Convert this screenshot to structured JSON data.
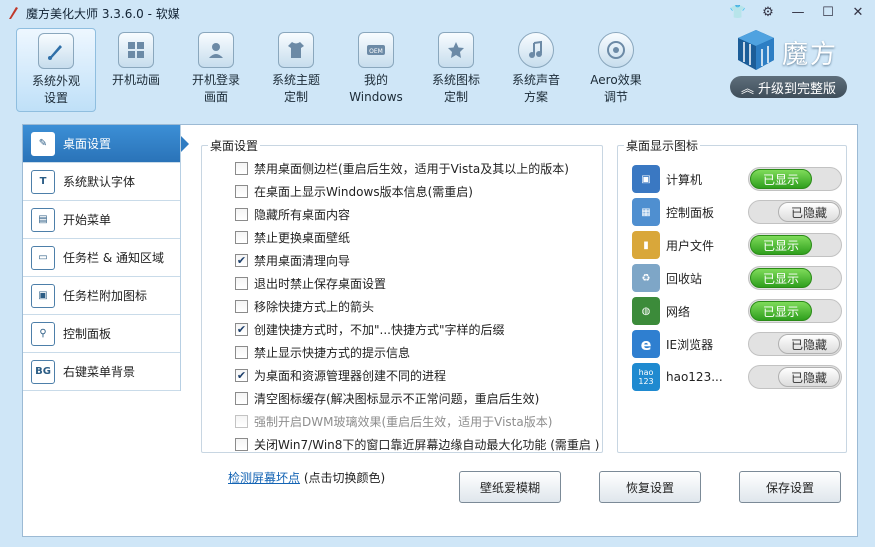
{
  "window": {
    "title": "魔方美化大师 3.3.6.0 - 软媒"
  },
  "nav": [
    {
      "label": "系统外观\n设置",
      "icon": "brush-icon"
    },
    {
      "label": "开机动画",
      "icon": "windows-logo-icon"
    },
    {
      "label": "开机登录\n画面",
      "icon": "user-login-icon"
    },
    {
      "label": "系统主题\n定制",
      "icon": "shirt-icon"
    },
    {
      "label": "我的\nWindows",
      "icon": "oem-icon"
    },
    {
      "label": "系统图标\n定制",
      "icon": "star-icon"
    },
    {
      "label": "系统声音\n方案",
      "icon": "music-note-icon"
    },
    {
      "label": "Aero效果\n调节",
      "icon": "disc-icon"
    }
  ],
  "brand": {
    "name": "魔方",
    "upgrade": "升级到完整版"
  },
  "sidebar": [
    {
      "label": "桌面设置",
      "icon": "desktop-settings-icon",
      "glyph": "✎"
    },
    {
      "label": "系统默认字体",
      "icon": "font-icon",
      "glyph": "T"
    },
    {
      "label": "开始菜单",
      "icon": "start-menu-icon",
      "glyph": "▤"
    },
    {
      "label": "任务栏 & 通知区域",
      "icon": "taskbar-icon",
      "glyph": "▭"
    },
    {
      "label": "任务栏附加图标",
      "icon": "taskbar-extra-icon",
      "glyph": "▣"
    },
    {
      "label": "控制面板",
      "icon": "control-panel-icon",
      "glyph": "⚲"
    },
    {
      "label": "右键菜单背景",
      "icon": "context-menu-bg-icon",
      "glyph": "BG"
    }
  ],
  "desktop_settings": {
    "title": "桌面设置",
    "options": [
      {
        "label": "禁用桌面侧边栏(重启后生效，适用于Vista及其以上的版本)",
        "checked": false,
        "disabled": false
      },
      {
        "label": "在桌面上显示Windows版本信息(需重启)",
        "checked": false,
        "disabled": false
      },
      {
        "label": "隐藏所有桌面内容",
        "checked": false,
        "disabled": false
      },
      {
        "label": "禁止更换桌面壁纸",
        "checked": false,
        "disabled": false
      },
      {
        "label": "禁用桌面清理向导",
        "checked": true,
        "disabled": false
      },
      {
        "label": "退出时禁止保存桌面设置",
        "checked": false,
        "disabled": false
      },
      {
        "label": "移除快捷方式上的箭头",
        "checked": false,
        "disabled": false
      },
      {
        "label": "创建快捷方式时，不加\"...快捷方式\"字样的后缀",
        "checked": true,
        "disabled": false
      },
      {
        "label": "禁止显示快捷方式的提示信息",
        "checked": false,
        "disabled": false
      },
      {
        "label": "为桌面和资源管理器创建不同的进程",
        "checked": true,
        "disabled": false
      },
      {
        "label": "清空图标缓存(解决图标显示不正常问题，重启后生效)",
        "checked": false,
        "disabled": false
      },
      {
        "label": "强制开启DWM玻璃效果(重启后生效，适用于Vista版本)",
        "checked": false,
        "disabled": true
      },
      {
        "label": "关闭Win7/Win8下的窗口靠近屏幕边缘自动最大化功能 (需重启 )",
        "checked": false,
        "disabled": false
      }
    ]
  },
  "desktop_icons": {
    "title": "桌面显示图标",
    "items": [
      {
        "label": "计算机",
        "state": "已显示",
        "on": true,
        "icon": "computer-icon",
        "color": "#3a78c2"
      },
      {
        "label": "控制面板",
        "state": "已隐藏",
        "on": false,
        "icon": "control-panel-icon",
        "color": "#4f8fd0"
      },
      {
        "label": "用户文件",
        "state": "已显示",
        "on": true,
        "icon": "user-folder-icon",
        "color": "#d9a73a"
      },
      {
        "label": "回收站",
        "state": "已显示",
        "on": true,
        "icon": "recycle-bin-icon",
        "color": "#7ea6c7"
      },
      {
        "label": "网络",
        "state": "已显示",
        "on": true,
        "icon": "network-globe-icon",
        "color": "#3c8b3a"
      },
      {
        "label": "IE浏览器",
        "state": "已隐藏",
        "on": false,
        "icon": "ie-browser-icon",
        "color": "#2f7fd0"
      },
      {
        "label": "hao123...",
        "state": "已隐藏",
        "on": false,
        "icon": "hao123-icon",
        "color": "#1f8ad0"
      }
    ]
  },
  "footer": {
    "link": "检测屏幕坏点",
    "hint": " (点击切换颜色)",
    "buttons": [
      "壁纸爱模糊",
      "恢复设置",
      "保存设置"
    ]
  }
}
